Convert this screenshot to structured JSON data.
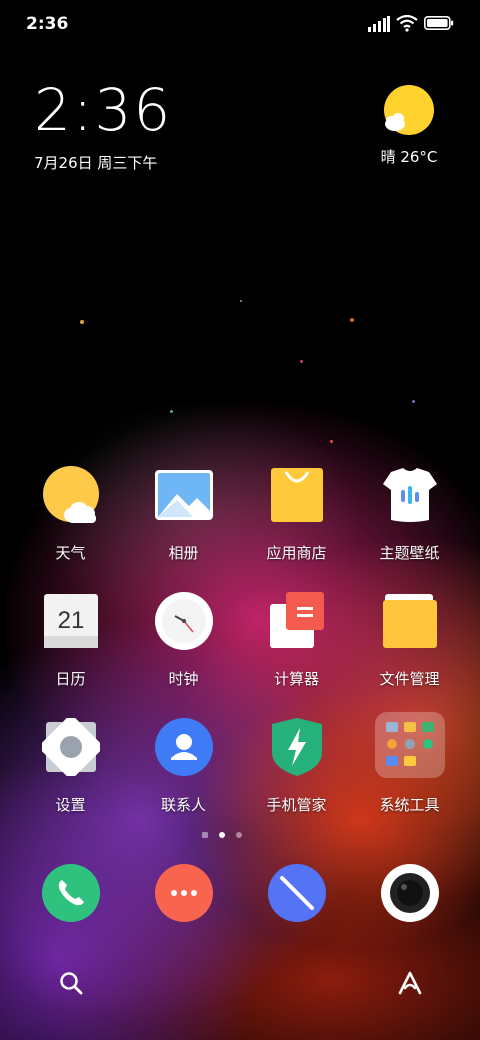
{
  "status_bar": {
    "time": "2:36"
  },
  "clock_widget": {
    "time": "2:36",
    "date": "7月26日 周三下午"
  },
  "weather_widget": {
    "condition_temp": "晴 26°C",
    "icon": "sunny-cloud-icon"
  },
  "apps": [
    {
      "label": "天气",
      "icon": "weather-icon"
    },
    {
      "label": "相册",
      "icon": "gallery-icon"
    },
    {
      "label": "应用商店",
      "icon": "app-store-icon"
    },
    {
      "label": "主题壁纸",
      "icon": "themes-icon"
    },
    {
      "label": "日历",
      "icon": "calendar-icon",
      "day": "21"
    },
    {
      "label": "时钟",
      "icon": "clock-icon"
    },
    {
      "label": "计算器",
      "icon": "calculator-icon"
    },
    {
      "label": "文件管理",
      "icon": "file-manager-icon"
    },
    {
      "label": "设置",
      "icon": "settings-icon"
    },
    {
      "label": "联系人",
      "icon": "contacts-icon"
    },
    {
      "label": "手机管家",
      "icon": "security-icon"
    },
    {
      "label": "系统工具",
      "icon": "folder-icon"
    }
  ],
  "page_indicator": {
    "current": 2,
    "total": 3
  },
  "dock": [
    {
      "icon": "phone-icon"
    },
    {
      "icon": "messages-icon"
    },
    {
      "icon": "browser-icon"
    },
    {
      "icon": "camera-icon"
    }
  ],
  "bottom_bar": {
    "left_icon": "search-icon",
    "right_icon": "assistant-icon"
  },
  "colors": {
    "weather_sun": "#FFC94A",
    "gallery_blue": "#4EA3F5",
    "store_yellow": "#FFC93C",
    "calc_red": "#F45B4E",
    "files_yellow": "#FFC53D",
    "contacts_blue": "#3F7BF5",
    "security_green": "#26B07A",
    "phone_green": "#2EC27E",
    "messages_red": "#F9644E",
    "browser_blue": "#5473F5"
  }
}
